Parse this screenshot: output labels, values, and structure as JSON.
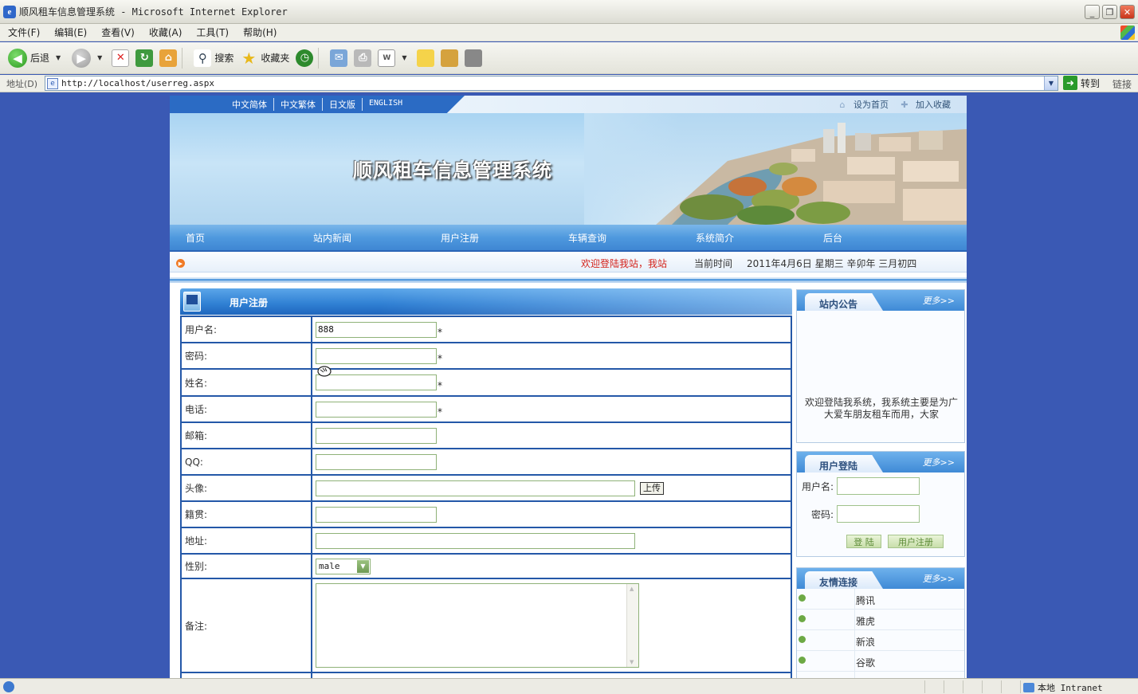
{
  "window": {
    "title": "顺风租车信息管理系统 - Microsoft Internet Explorer"
  },
  "menu": [
    "文件(F)",
    "编辑(E)",
    "查看(V)",
    "收藏(A)",
    "工具(T)",
    "帮助(H)"
  ],
  "toolbar": {
    "back_label": "后退",
    "search_label": "搜索",
    "favorites_label": "收藏夹"
  },
  "address": {
    "label": "地址(D)",
    "url": "http://localhost/userreg.aspx",
    "go_label": "转到",
    "links_label": "链接"
  },
  "status": {
    "zone": "本地 Intranet"
  },
  "site": {
    "languages": [
      "中文简体",
      "中文繁体",
      "日文版",
      "ENGLISH"
    ],
    "set_home": "设为首页",
    "add_favorite": "加入收藏",
    "title": "顺风租车信息管理系统",
    "nav": [
      "首页",
      "站内新闻",
      "用户注册",
      "车辆查询",
      "系统简介",
      "后台"
    ],
    "welcome": "欢迎登陆我站，我站",
    "time_label": "当前时间",
    "time_value": "2011年4月6日 星期三 辛卯年 三月初四"
  },
  "register": {
    "title": "用户注册",
    "fields": {
      "username_label": "用户名:",
      "username_value": "888",
      "password_label": "密码:",
      "name_label": "姓名:",
      "phone_label": "电话:",
      "email_label": "邮箱:",
      "qq_label": "QQ:",
      "avatar_label": "头像:",
      "upload_label": "上传",
      "native_label": "籍贯:",
      "address_label": "地址:",
      "gender_label": "性别:",
      "gender_value": "male",
      "remark_label": "备注:",
      "required_mark": "*"
    }
  },
  "sidebar": {
    "more_label": "更多>>",
    "notice": {
      "title": "站内公告",
      "text": "欢迎登陆我系统，我系统主要是为广大爱车朋友租车而用，大家"
    },
    "login": {
      "title": "用户登陆",
      "username_label": "用户名:",
      "password_label": "密码:",
      "login_button": "登 陆",
      "register_button": "用户注册"
    },
    "links": {
      "title": "友情连接",
      "items": [
        "腾讯",
        "雅虎",
        "新浪",
        "谷歌"
      ]
    }
  },
  "colors": {
    "desktop_bg": "#3a59b4",
    "nav_blue": "#3f86d3",
    "table_border": "#2458a8",
    "welcome_red": "#d4231b"
  }
}
